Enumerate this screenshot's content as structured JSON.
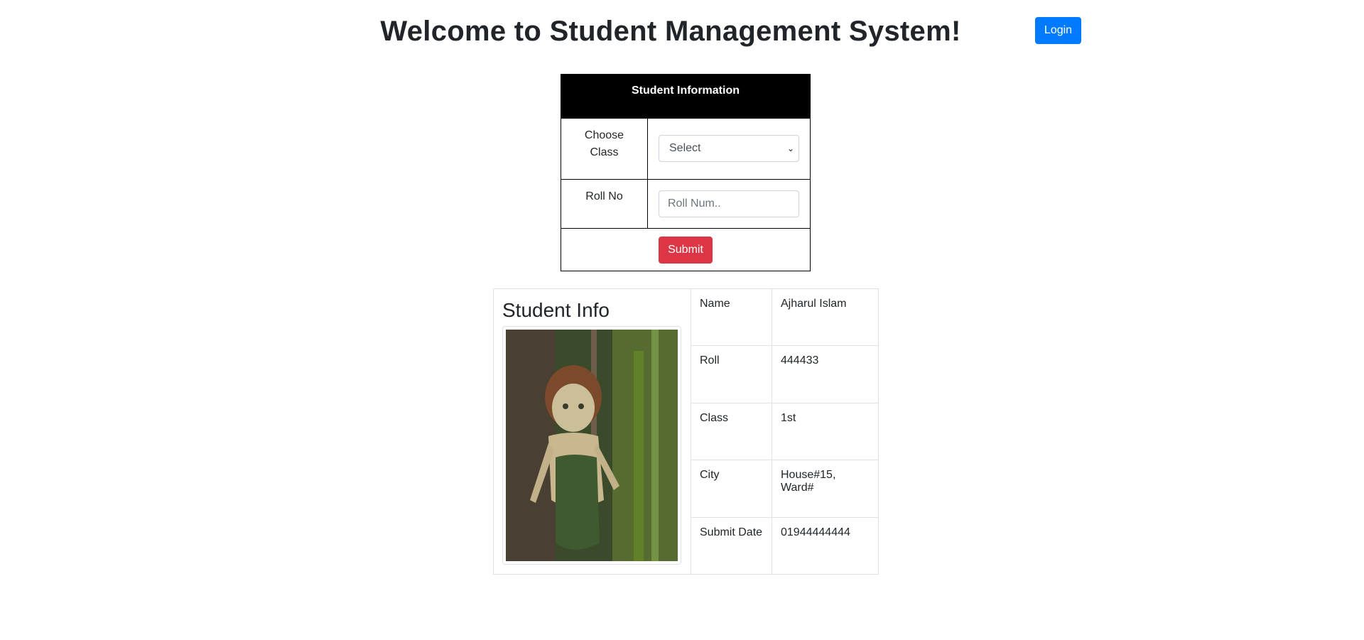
{
  "header": {
    "title": "Welcome to Student Management System!",
    "login_label": "Login"
  },
  "form": {
    "heading": "Student Information",
    "class_label": "Choose Class",
    "class_selected": "Select",
    "roll_label": "Roll No",
    "roll_placeholder": "Roll Num..",
    "submit_label": "Submit"
  },
  "student": {
    "heading": "Student Info",
    "fields": [
      {
        "label": "Name",
        "value": "Ajharul Islam"
      },
      {
        "label": "Roll",
        "value": "444433"
      },
      {
        "label": "Class",
        "value": "1st"
      },
      {
        "label": "City",
        "value": "House#15, Ward#"
      },
      {
        "label": "Submit Date",
        "value": "01944444444"
      }
    ]
  },
  "colors": {
    "login_button": "#007bff",
    "submit_button": "#dc3545",
    "form_header_bg": "#000000"
  }
}
